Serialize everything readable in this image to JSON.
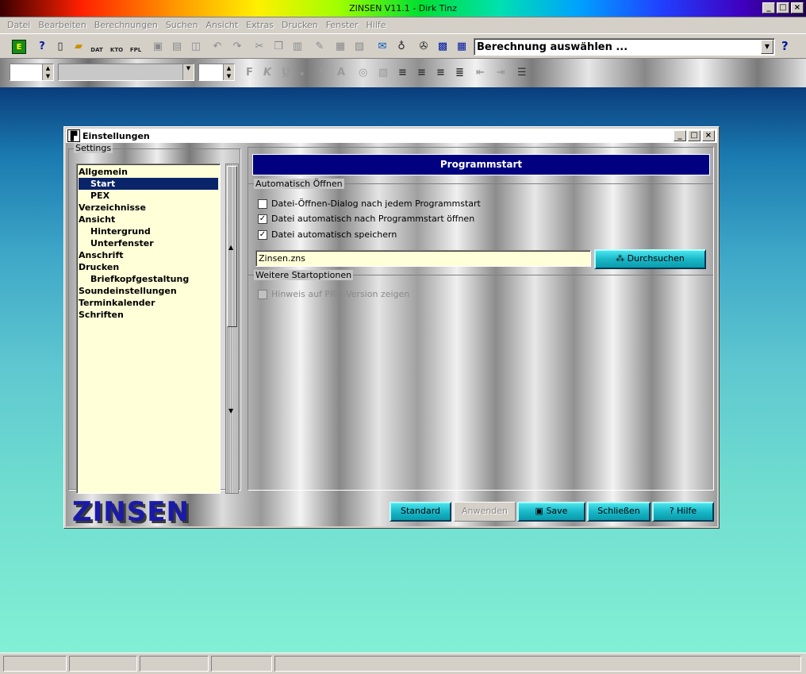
{
  "app": {
    "title": "ZINSEN V11.1 - Dirk Tinz"
  },
  "menu": [
    "Datei",
    "Bearbeiten",
    "Berechnungen",
    "Suchen",
    "Ansicht",
    "Extras",
    "Drucken",
    "Fenster",
    "Hilfe"
  ],
  "toolbar": {
    "calc_select": "Berechnung auswählen ...",
    "help": "?",
    "icons": [
      "exit-icon",
      "context-help-icon",
      "new-file-icon",
      "open-file-icon",
      "open-dat-icon",
      "open-kto-icon",
      "open-fpl-icon",
      "save-icon",
      "print-icon",
      "print-preview-icon",
      "undo-icon",
      "redo-icon",
      "cut-icon",
      "copy-icon",
      "paste-icon",
      "brush-icon",
      "doc1-icon",
      "doc2-icon",
      "mail-icon",
      "find-icon",
      "tools-icon",
      "calculator-icon",
      "calendar-icon"
    ],
    "icon_labels": {
      "dat": "DAT",
      "kto": "KTO",
      "fpl": "FPL"
    }
  },
  "format_bar": {
    "bold": "F",
    "italic": "K",
    "underline": "U"
  },
  "dialog": {
    "title": "Einstellungen",
    "settings_label": "Settings",
    "tree": [
      {
        "label": "Allgemein",
        "level": 0
      },
      {
        "label": "Start",
        "level": 1,
        "selected": true
      },
      {
        "label": "PEX",
        "level": 1
      },
      {
        "label": "Verzeichnisse",
        "level": 0
      },
      {
        "label": "Ansicht",
        "level": 0
      },
      {
        "label": "Hintergrund",
        "level": 1
      },
      {
        "label": "Unterfenster",
        "level": 1
      },
      {
        "label": "Anschrift",
        "level": 0
      },
      {
        "label": "Drucken",
        "level": 0
      },
      {
        "label": "Briefkopfgestaltung",
        "level": 1
      },
      {
        "label": "Soundeinstellungen",
        "level": 0
      },
      {
        "label": "Terminkalender",
        "level": 0
      },
      {
        "label": "Schriften",
        "level": 0
      }
    ],
    "header": "Programmstart",
    "auto_open": {
      "label": "Automatisch Öffnen",
      "checkboxes": [
        {
          "label": "Datei-Öffnen-Dialog nach jedem Programmstart",
          "checked": false
        },
        {
          "label": "Datei automatisch nach Programmstart öffnen",
          "checked": true
        },
        {
          "label": "Datei automatisch speichern",
          "checked": true
        }
      ],
      "path_value": "Zinsen.zns",
      "browse_label": "Durchsuchen"
    },
    "more_options": {
      "label": "Weitere Startoptionen",
      "checkbox": {
        "label": "Hinweis auf PRO-Version zeigen",
        "checked": false,
        "disabled": true
      }
    },
    "logo": "ZINSEN",
    "buttons": {
      "standard": "Standard",
      "apply": "Anwenden",
      "save": "Save",
      "close": "Schließen",
      "help": "Hilfe"
    }
  }
}
